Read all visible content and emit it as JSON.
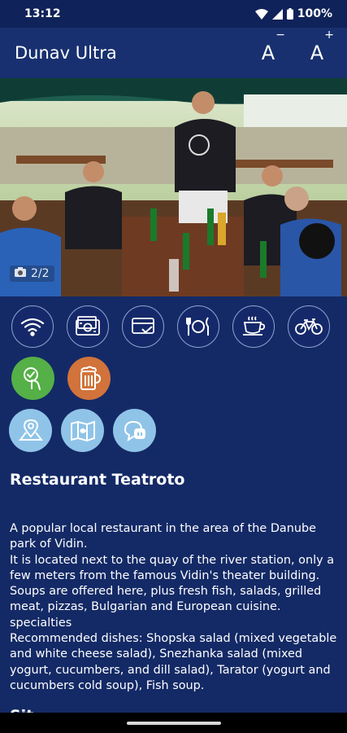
{
  "status_bar": {
    "time": "13:12",
    "battery": "100%"
  },
  "app_bar": {
    "title": "Dunav Ultra",
    "font_decrease": "A",
    "font_decrease_sup": "−",
    "font_increase": "A",
    "font_increase_sup": "+"
  },
  "gallery": {
    "counter": "2/2"
  },
  "amenities": [
    {
      "icon": "wifi-icon"
    },
    {
      "icon": "cash-icon"
    },
    {
      "icon": "card-payment-icon"
    },
    {
      "icon": "restaurant-icon"
    },
    {
      "icon": "coffee-icon"
    },
    {
      "icon": "bicycle-icon"
    }
  ],
  "features": [
    {
      "icon": "touch-check-icon",
      "color": "#55b047"
    },
    {
      "icon": "beer-mug-icon",
      "color": "#d1733b"
    }
  ],
  "actions": [
    {
      "icon": "map-pin-icon",
      "color": "#8fc4e8"
    },
    {
      "icon": "map-icon",
      "color": "#8fc4e8"
    },
    {
      "icon": "chat-icon",
      "color": "#8fc4e8"
    }
  ],
  "restaurant": {
    "name": "Restaurant Teatroto",
    "description": "A popular local restaurant in the area of the Danube park of Vidin.\nIt is located next to the quay of the river station, only a few meters from the famous Vidin's theater building. Soups are offered here, plus fresh fish, salads, grilled meat, pizzas, Bulgarian and European cuisine. specialties\nRecommended dishes: Shopska salad (mixed vegetable and white cheese salad), Snezhanka salad (mixed yogurt, cucumbers, and dill salad), Tarator (yogurt and cucumbers cold soup), Fish soup.",
    "next_section_partial": "Sit"
  }
}
